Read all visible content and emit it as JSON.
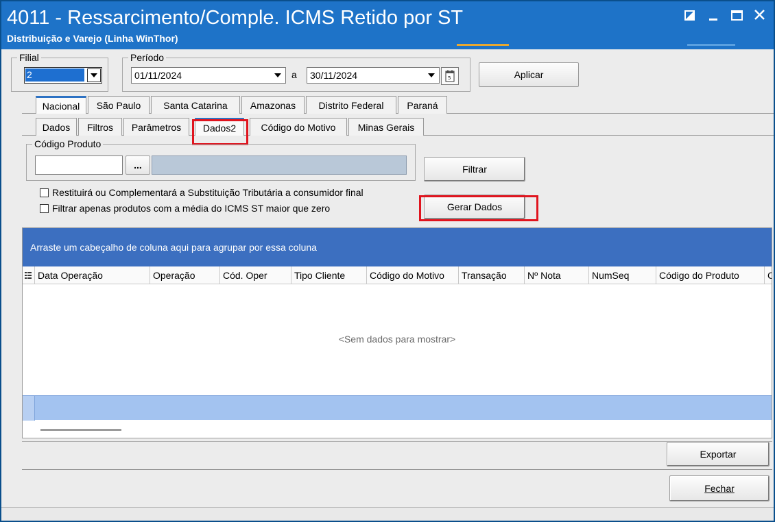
{
  "window": {
    "title": "4011 - Ressarcimento/Comple. ICMS Retido por ST",
    "subtitle": "Distribuição e Varejo (Linha WinThor)"
  },
  "filial": {
    "label": "Filial",
    "value": "2"
  },
  "periodo": {
    "label": "Período",
    "start": "01/11/2024",
    "separator": "a",
    "end": "30/11/2024"
  },
  "buttons": {
    "aplicar": "Aplicar",
    "filtrar": "Filtrar",
    "gerar_dados": "Gerar Dados",
    "exportar": "Exportar",
    "fechar": "Fechar",
    "browse": "..."
  },
  "tabs_top": [
    "Nacional",
    "São Paulo",
    "Santa Catarina",
    "Amazonas",
    "Distrito Federal",
    "Paraná"
  ],
  "tabs_sub": [
    "Dados",
    "Filtros",
    "Parâmetros",
    "Dados2",
    "Código do Motivo",
    "Minas Gerais"
  ],
  "codigo_produto": {
    "label": "Código Produto",
    "value": ""
  },
  "checkboxes": [
    {
      "label": "Restituirá ou Complementará a Substituição Tributária a consumidor final",
      "checked": false
    },
    {
      "label": "Filtrar apenas produtos com a média do ICMS ST maior que zero",
      "checked": false
    }
  ],
  "grid": {
    "group_hint": "Arraste um cabeçalho de coluna aqui para agrupar por essa coluna",
    "columns": [
      "Data Operação",
      "Operação",
      "Cód. Oper",
      "Tipo Cliente",
      "Código do Motivo",
      "Transação",
      "Nº Nota",
      "NumSeq",
      "Código do Produto",
      "C"
    ],
    "empty_text": "<Sem dados para mostrar>",
    "rows": []
  },
  "icons": {
    "window": [
      "restore-icon",
      "minimize-icon",
      "maximize-icon",
      "close-icon"
    ],
    "calendar": "calendar-icon",
    "dropdown": "chevron-down-icon",
    "column_chooser": "column-chooser-icon"
  },
  "colors": {
    "titlebar": "#1e73c8",
    "group_panel": "#3c6fc0",
    "highlight": "#e0141e",
    "active_tab_accent": "#2d72c3"
  }
}
